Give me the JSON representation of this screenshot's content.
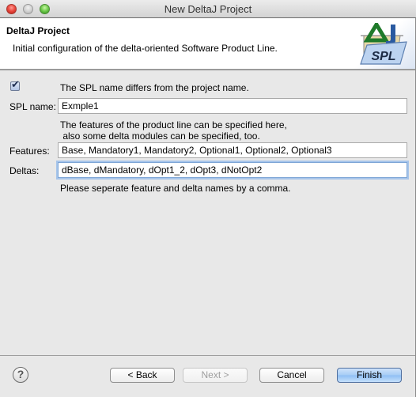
{
  "window": {
    "title": "New DeltaJ Project"
  },
  "header": {
    "title": "DeltaJ Project",
    "description": "Initial configuration of the delta-oriented Software Product Line.",
    "logo_text": "SPL",
    "logo_icon": "deltaj-spl-folder-icon"
  },
  "form": {
    "checkbox": {
      "checked": true,
      "label": "The SPL name differs from the project name."
    },
    "spl_name": {
      "label": "SPL name:",
      "value": "Exmple1"
    },
    "features_hint_line1": "The features of the product line can be specified here,",
    "features_hint_line2": " also some delta modules can be specified, too.",
    "features": {
      "label": "Features:",
      "value": "Base, Mandatory1, Mandatory2, Optional1, Optional2, Optional3"
    },
    "deltas": {
      "label": "Deltas:",
      "value": "dBase, dMandatory, dOpt1_2, dOpt3, dNotOpt2"
    },
    "separator_hint": "Please seperate feature and delta names by a comma."
  },
  "footer": {
    "help_icon": "?",
    "back_label": "< Back",
    "next_label": "Next >",
    "cancel_label": "Cancel",
    "finish_label": "Finish"
  }
}
